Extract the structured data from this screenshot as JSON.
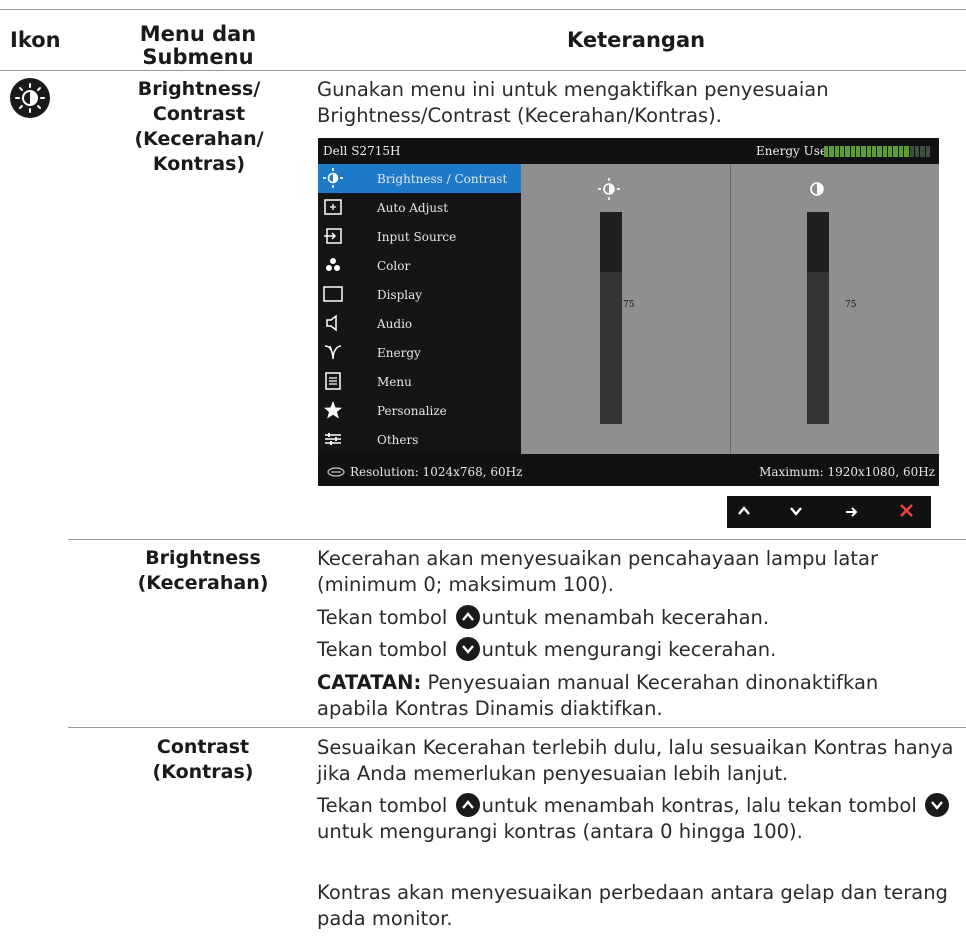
{
  "header": {
    "ikon": "Ikon",
    "menu": "Menu dan Submenu",
    "keterangan": "Keterangan"
  },
  "main": {
    "icon": "brightness-icon",
    "menu_title": "Brightness/ Contrast (Kecerahan/ Kontras)",
    "intro": "Gunakan menu ini untuk mengaktifkan penyesuaian Brightness/Contrast (Kecerahan/Kontras)."
  },
  "osd": {
    "title": "Dell S2715H",
    "energy_label": "Energy Use",
    "energy_level": 0.8,
    "menu_items": [
      {
        "label": "Brightness / Contrast",
        "icon": "brightness-icon"
      },
      {
        "label": "Auto Adjust",
        "icon": "auto-adjust-icon"
      },
      {
        "label": "Input Source",
        "icon": "input-source-icon"
      },
      {
        "label": "Color",
        "icon": "color-icon"
      },
      {
        "label": "Display",
        "icon": "display-icon"
      },
      {
        "label": "Audio",
        "icon": "audio-icon"
      },
      {
        "label": "Energy",
        "icon": "energy-icon"
      },
      {
        "label": "Menu",
        "icon": "menu-icon"
      },
      {
        "label": "Personalize",
        "icon": "star-icon"
      },
      {
        "label": "Others",
        "icon": "others-icon"
      }
    ],
    "brightness_value": "75",
    "contrast_value": "75",
    "resolution": "Resolution: 1024x768, 60Hz",
    "maximum": "Maximum: 1920x1080, 60Hz",
    "nav_buttons": [
      "up-arrow-icon",
      "down-arrow-icon",
      "right-arrow-icon",
      "close-icon"
    ]
  },
  "brightness": {
    "title": "Brightness (Kecerahan)",
    "p1": "Kecerahan akan menyesuaikan pencahayaan lampu latar (minimum 0; maksimum 100).",
    "p2_pre": "Tekan tombol",
    "p2_post": "untuk menambah kecerahan.",
    "p3_pre": "Tekan tombol",
    "p3_post": "untuk mengurangi kecerahan.",
    "note_label": "CATATAN:",
    "note_text": " Penyesuaian manual Kecerahan dinonaktifkan apabila Kontras Dinamis diaktifkan."
  },
  "contrast": {
    "title": "Contrast (Kontras)",
    "p1": "Sesuaikan Kecerahan terlebih dulu, lalu sesuaikan Kontras hanya jika Anda memerlukan penyesuaian lebih lanjut.",
    "p2_pre": "Tekan tombol",
    "p2_mid": "untuk menambah kontras, lalu tekan tombol",
    "p2_post": "untuk mengurangi kontras (antara 0 hingga 100).",
    "p3": "Kontras akan menyesuaikan perbedaan antara gelap dan terang pada monitor."
  }
}
